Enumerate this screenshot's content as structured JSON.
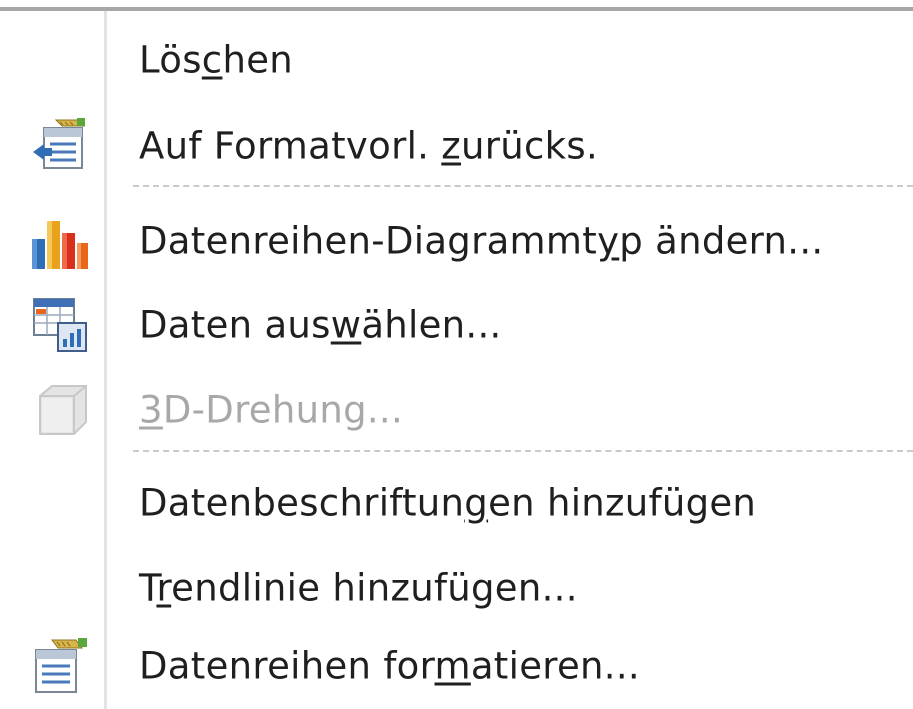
{
  "menu": {
    "items": [
      {
        "pre": "Lös",
        "acc": "c",
        "post": "hen",
        "icon": "",
        "disabled": false
      },
      {
        "pre": "Auf Formatvorl. ",
        "acc": "z",
        "post": "urücks.",
        "icon": "reset-style-icon",
        "disabled": false
      },
      {
        "pre": "Datenreihen-Diagrammt",
        "acc": "y",
        "post": "p ändern...",
        "icon": "bar-chart-icon",
        "disabled": false
      },
      {
        "pre": "Daten aus",
        "acc": "w",
        "post": "ählen...",
        "icon": "select-data-icon",
        "disabled": false
      },
      {
        "pre": "",
        "acc": "3",
        "post": "D-Drehung...",
        "icon": "3d-rotation-icon",
        "disabled": true
      },
      {
        "pre": "Datenbeschriftun",
        "acc": "g",
        "post": "en hinzufügen",
        "icon": "",
        "disabled": false
      },
      {
        "pre": "T",
        "acc": "r",
        "post": "endlinie hinzufügen...",
        "icon": "",
        "disabled": false
      },
      {
        "pre": "Datenreihen for",
        "acc": "m",
        "post": "atieren...",
        "icon": "format-series-icon",
        "disabled": false
      }
    ]
  },
  "colors": {
    "text": "#1f1f1f",
    "disabled_text": "#a8a8a8",
    "separator": "#c9c9c9",
    "chart_orange": "#e8671c",
    "chart_blue": "#2f6db5",
    "chart_green": "#5aa83a"
  }
}
